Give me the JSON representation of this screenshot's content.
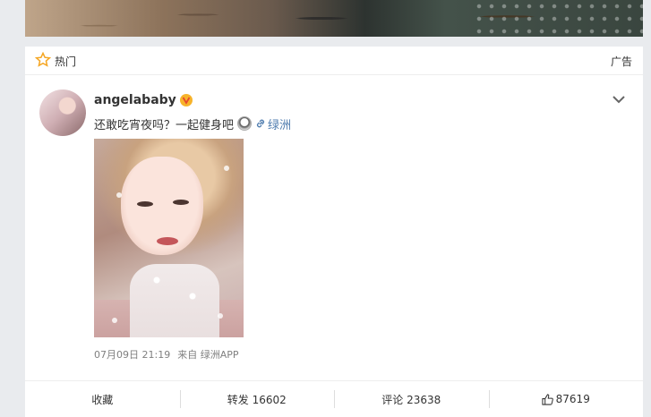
{
  "hot_section": {
    "label": "热门",
    "ad_label": "广告"
  },
  "post": {
    "author": "angelababy",
    "text": "还敢吃宵夜吗？一起健身吧",
    "link_label": "绿洲",
    "timestamp": "07月09日 21:19",
    "source": "来自 绿洲APP"
  },
  "actions": {
    "favorite": "收藏",
    "repost": "转发 16602",
    "comment": "评论 23638",
    "like": "87619"
  },
  "icons": {
    "hot": "star-icon",
    "verified": "verified-v-icon",
    "expand": "chevron-down-icon",
    "link": "link-icon",
    "like": "thumbs-up-icon"
  },
  "colors": {
    "link": "#507daf",
    "verified_badge": "#f7b32b",
    "hot_star": "#f5a623"
  }
}
